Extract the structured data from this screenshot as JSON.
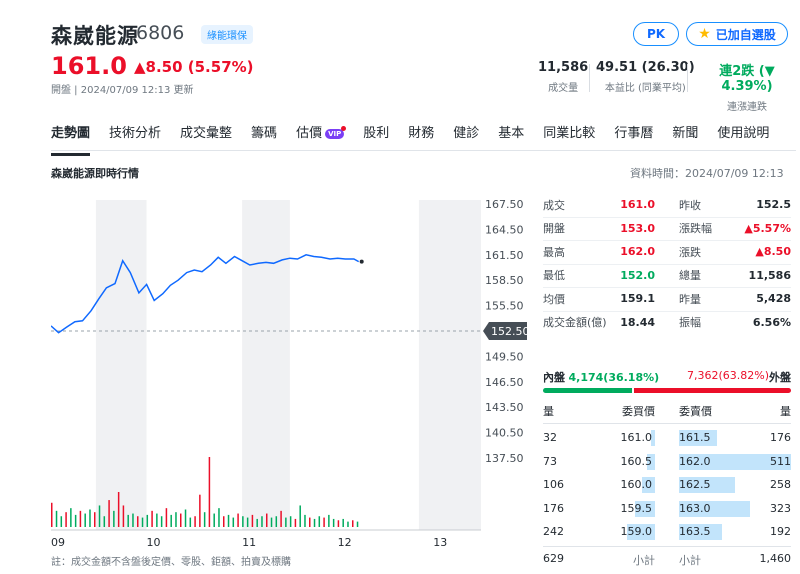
{
  "header": {
    "name": "森崴能源",
    "code": "6806",
    "tag": "綠能環保",
    "price": "161.0",
    "change": "▲8.50 (5.57%)",
    "update": "開盤 | 2024/07/09 12:13 更新",
    "pk_label": "PK",
    "watch_label": "已加自選股"
  },
  "stats": [
    {
      "value": "11,586",
      "label": "成交量"
    },
    {
      "value": "49.51 (26.30)",
      "label": "本益比 (同業平均)"
    },
    {
      "value": "連2跌 (▼ 4.39%)",
      "label": "連漲連跌"
    }
  ],
  "nav": [
    "走勢圖",
    "技術分析",
    "成交彙整",
    "籌碼",
    "估價",
    "股利",
    "財務",
    "健診",
    "基本",
    "同業比較",
    "行事曆",
    "新聞",
    "使用說明"
  ],
  "nav_vip": "VIP",
  "section_title": "森崴能源即時行情",
  "data_time": "資料時間：2024/07/09 12:13",
  "quote": {
    "left": [
      {
        "label": "成交",
        "value": "161.0",
        "color": "#eb0f29"
      },
      {
        "label": "開盤",
        "value": "153.0",
        "color": "#eb0f29"
      },
      {
        "label": "最高",
        "value": "162.0",
        "color": "#eb0f29"
      },
      {
        "label": "最低",
        "value": "152.0",
        "color": "#00ab5e"
      },
      {
        "label": "均價",
        "value": "159.1",
        "color": "#232a31"
      },
      {
        "label": "成交金額(億)",
        "value": "18.44",
        "color": "#232a31"
      }
    ],
    "right": [
      {
        "label": "昨收",
        "value": "152.5",
        "color": "#232a31"
      },
      {
        "label": "漲跌幅",
        "value": "▲5.57%",
        "color": "#eb0f29"
      },
      {
        "label": "漲跌",
        "value": "▲8.50",
        "color": "#eb0f29"
      },
      {
        "label": "總量",
        "value": "11,586",
        "color": "#232a31"
      },
      {
        "label": "昨量",
        "value": "5,428",
        "color": "#232a31"
      },
      {
        "label": "振幅",
        "value": "6.56%",
        "color": "#232a31"
      }
    ]
  },
  "inner_outer": {
    "inner_label": "內盤",
    "inner_value": "4,174(36.18%)",
    "outer_value": "7,362(63.82%)",
    "outer_label": "外盤",
    "inner_pct": 36.18
  },
  "orderbook": {
    "headers": [
      "量",
      "委買價",
      "委賣價",
      "量"
    ],
    "bids": [
      {
        "qty": "32",
        "price": "161.0",
        "ratio": 0.06
      },
      {
        "qty": "73",
        "price": "160.5",
        "ratio": 0.14
      },
      {
        "qty": "106",
        "price": "160.0",
        "ratio": 0.21
      },
      {
        "qty": "176",
        "price": "159.5",
        "ratio": 0.34
      },
      {
        "qty": "242",
        "price": "159.0",
        "ratio": 0.47
      }
    ],
    "asks": [
      {
        "price": "161.5",
        "qty": "176",
        "ratio": 0.34
      },
      {
        "price": "162.0",
        "qty": "511",
        "ratio": 1.0
      },
      {
        "price": "162.5",
        "qty": "258",
        "ratio": 0.5
      },
      {
        "price": "163.0",
        "qty": "323",
        "ratio": 0.63
      },
      {
        "price": "163.5",
        "qty": "192",
        "ratio": 0.38
      }
    ],
    "total_label": "小計",
    "bid_total": "629",
    "ask_total": "1,460"
  },
  "note": "註：成交金額不含盤後定價、零股、鉅額、拍賣及標購",
  "chart_data": {
    "type": "line",
    "y_ticks": [
      "167.50",
      "164.50",
      "161.50",
      "158.50",
      "155.50",
      "152.50",
      "149.50",
      "146.50",
      "143.50",
      "140.50",
      "137.50"
    ],
    "ylim": [
      137.5,
      167.5
    ],
    "x_ticks": [
      "09",
      "10",
      "11",
      "12",
      "13"
    ],
    "x_tick_hours": [
      9,
      10,
      11,
      12,
      13
    ],
    "xlim": [
      9,
      13.5
    ],
    "reference": "152.50",
    "reference_value": 152.5,
    "price_series": [
      [
        9.0,
        153.1
      ],
      [
        9.08,
        152.3
      ],
      [
        9.17,
        153.0
      ],
      [
        9.25,
        153.6
      ],
      [
        9.33,
        153.7
      ],
      [
        9.42,
        154.9
      ],
      [
        9.5,
        156.3
      ],
      [
        9.58,
        157.6
      ],
      [
        9.67,
        158.1
      ],
      [
        9.75,
        160.8
      ],
      [
        9.83,
        159.4
      ],
      [
        9.92,
        157.0
      ],
      [
        10.0,
        158.0
      ],
      [
        10.08,
        156.1
      ],
      [
        10.17,
        156.9
      ],
      [
        10.25,
        157.9
      ],
      [
        10.33,
        158.5
      ],
      [
        10.42,
        159.4
      ],
      [
        10.5,
        159.7
      ],
      [
        10.58,
        159.5
      ],
      [
        10.67,
        160.3
      ],
      [
        10.75,
        161.2
      ],
      [
        10.83,
        160.5
      ],
      [
        10.92,
        161.3
      ],
      [
        11.0,
        160.8
      ],
      [
        11.08,
        160.3
      ],
      [
        11.17,
        160.5
      ],
      [
        11.25,
        160.6
      ],
      [
        11.33,
        160.5
      ],
      [
        11.42,
        160.9
      ],
      [
        11.5,
        161.1
      ],
      [
        11.58,
        161.0
      ],
      [
        11.67,
        161.5
      ],
      [
        11.75,
        161.3
      ],
      [
        11.83,
        161.2
      ],
      [
        11.92,
        161.0
      ],
      [
        12.0,
        161.1
      ],
      [
        12.08,
        161.0
      ],
      [
        12.17,
        161.0
      ],
      [
        12.22,
        160.7
      ]
    ],
    "volume_series": [
      [
        9.0,
        90
      ],
      [
        9.05,
        60
      ],
      [
        9.1,
        40
      ],
      [
        9.15,
        55
      ],
      [
        9.2,
        70
      ],
      [
        9.25,
        45
      ],
      [
        9.3,
        60
      ],
      [
        9.35,
        50
      ],
      [
        9.4,
        65
      ],
      [
        9.45,
        55
      ],
      [
        9.5,
        80
      ],
      [
        9.55,
        40
      ],
      [
        9.6,
        100
      ],
      [
        9.65,
        60
      ],
      [
        9.7,
        130
      ],
      [
        9.75,
        80
      ],
      [
        9.8,
        45
      ],
      [
        9.85,
        50
      ],
      [
        9.9,
        40
      ],
      [
        9.95,
        35
      ],
      [
        10.0,
        45
      ],
      [
        10.05,
        60
      ],
      [
        10.1,
        50
      ],
      [
        10.15,
        40
      ],
      [
        10.2,
        70
      ],
      [
        10.25,
        45
      ],
      [
        10.3,
        55
      ],
      [
        10.35,
        50
      ],
      [
        10.4,
        65
      ],
      [
        10.45,
        35
      ],
      [
        10.5,
        40
      ],
      [
        10.55,
        120
      ],
      [
        10.6,
        55
      ],
      [
        10.65,
        260
      ],
      [
        10.7,
        50
      ],
      [
        10.75,
        70
      ],
      [
        10.8,
        40
      ],
      [
        10.85,
        45
      ],
      [
        10.9,
        35
      ],
      [
        10.95,
        50
      ],
      [
        11.0,
        40
      ],
      [
        11.05,
        35
      ],
      [
        11.1,
        45
      ],
      [
        11.15,
        30
      ],
      [
        11.2,
        40
      ],
      [
        11.25,
        50
      ],
      [
        11.3,
        35
      ],
      [
        11.35,
        40
      ],
      [
        11.4,
        60
      ],
      [
        11.45,
        35
      ],
      [
        11.5,
        40
      ],
      [
        11.55,
        30
      ],
      [
        11.6,
        80
      ],
      [
        11.65,
        45
      ],
      [
        11.7,
        35
      ],
      [
        11.75,
        30
      ],
      [
        11.8,
        40
      ],
      [
        11.85,
        35
      ],
      [
        11.9,
        45
      ],
      [
        11.95,
        30
      ],
      [
        12.0,
        25
      ],
      [
        12.05,
        30
      ],
      [
        12.1,
        20
      ],
      [
        12.15,
        25
      ],
      [
        12.2,
        20
      ]
    ],
    "colors": {
      "line": "#0f69ff",
      "up": "#eb0f29",
      "down": "#00ab5e",
      "shade": "#f0f1f3"
    }
  }
}
